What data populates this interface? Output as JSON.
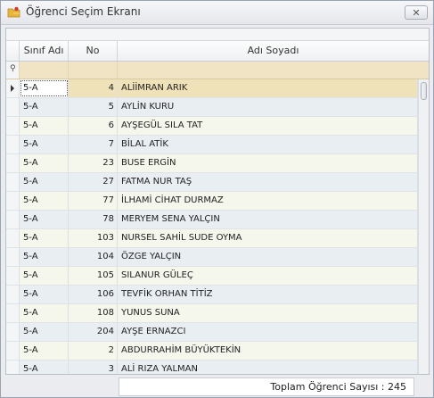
{
  "window": {
    "title": "Öğrenci Seçim Ekranı",
    "close_label": "✕",
    "title_icon": "folder-user-icon"
  },
  "grid": {
    "columns": [
      "Sınıf Adı",
      "No",
      "Adı Soyadı"
    ],
    "rows": [
      {
        "class": "5-A",
        "no": "4",
        "name": "ALİİMRAN ARIK"
      },
      {
        "class": "5-A",
        "no": "5",
        "name": "AYLİN KURU"
      },
      {
        "class": "5-A",
        "no": "6",
        "name": "AYŞEGÜL SILA TAT"
      },
      {
        "class": "5-A",
        "no": "7",
        "name": "BİLAL ATİK"
      },
      {
        "class": "5-A",
        "no": "23",
        "name": "BUSE ERGİN"
      },
      {
        "class": "5-A",
        "no": "27",
        "name": "FATMA NUR TAŞ"
      },
      {
        "class": "5-A",
        "no": "77",
        "name": "İLHAMİ CİHAT DURMAZ"
      },
      {
        "class": "5-A",
        "no": "78",
        "name": "MERYEM SENA YALÇIN"
      },
      {
        "class": "5-A",
        "no": "103",
        "name": "NURSEL SAHİL SUDE OYMA"
      },
      {
        "class": "5-A",
        "no": "104",
        "name": "ÖZGE YALÇIN"
      },
      {
        "class": "5-A",
        "no": "105",
        "name": "SILANUR GÜLEÇ"
      },
      {
        "class": "5-A",
        "no": "106",
        "name": "TEVFİK ORHAN TİTİZ"
      },
      {
        "class": "5-A",
        "no": "108",
        "name": "YUNUS SUNA"
      },
      {
        "class": "5-A",
        "no": "204",
        "name": "AYŞE ERNAZCI"
      },
      {
        "class": "5-A",
        "no": "2",
        "name": "ABDURRAHİM BÜYÜKTEKİN"
      },
      {
        "class": "5-A",
        "no": "3",
        "name": "ALİ RIZA YALMAN"
      }
    ],
    "selected_row_index": 0
  },
  "footer": {
    "total_label": "Toplam Öğrenci Sayısı : 245"
  },
  "colors": {
    "selected_row": "#efe1b8",
    "filter_row": "#f0e4c4",
    "row_even": "#f5f6ec",
    "row_odd": "#e9eef3"
  }
}
